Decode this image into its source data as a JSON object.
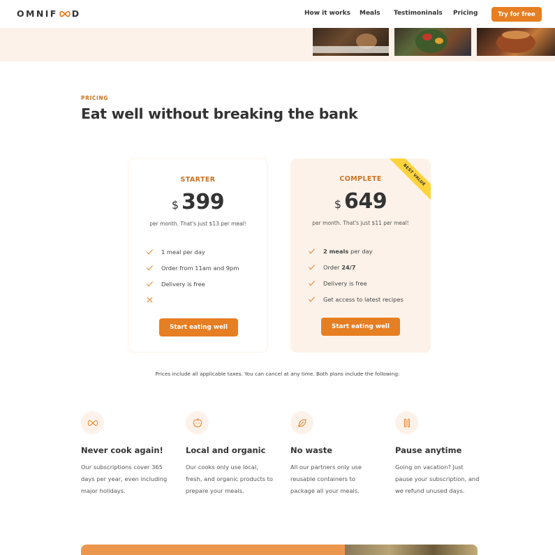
{
  "brand": {
    "logo_text": "OMNIFOOD",
    "accent": "#e67e22",
    "accent_dark": "#cf711f",
    "tint": "#fdf2e9",
    "ribbon": "#ffd43b"
  },
  "nav": {
    "items": [
      "How it works",
      "Meals",
      "Testimoninals",
      "Pricing"
    ],
    "cta_label": "Try for free"
  },
  "pricing": {
    "eyebrow": "PRICING",
    "heading": "Eat well without breaking the bank",
    "plans": [
      {
        "name": "STARTER",
        "currency": "$",
        "amount": "399",
        "per": "per month. That's just $13 per meal!",
        "features": [
          {
            "icon": "checkmark-icon",
            "text": "1 meal per day"
          },
          {
            "icon": "checkmark-icon",
            "text": "Order from 11am and 9pm"
          },
          {
            "icon": "checkmark-icon",
            "text": "Delivery is free"
          },
          {
            "icon": "close-icon",
            "text": ""
          }
        ],
        "button_label": "Start eating well"
      },
      {
        "name": "COMPLETE",
        "currency": "$",
        "amount": "649",
        "per": "per month. That's just $11 per meal!",
        "ribbon": "BEST VALUE",
        "features": [
          {
            "icon": "checkmark-icon",
            "bold": "2 meals",
            "text": " per day"
          },
          {
            "icon": "checkmark-icon",
            "prefix": "Order ",
            "bold": "24/7",
            "text": ""
          },
          {
            "icon": "checkmark-icon",
            "text": "Delivery is free"
          },
          {
            "icon": "checkmark-icon",
            "text": "Get access to latest recipes"
          }
        ],
        "button_label": "Start eating well"
      }
    ],
    "note": "Prices include all applicable taxes. You can cancel at any time. Both plans include the following:"
  },
  "features": [
    {
      "icon": "infinity-icon",
      "title": "Never cook again!",
      "text": "Our subscriptions cover 365 days per year, even including major holidays."
    },
    {
      "icon": "apple-icon",
      "title": "Local and organic",
      "text": "Our cooks only use local, fresh, and organic products to prepare your meals."
    },
    {
      "icon": "leaf-icon",
      "title": "No waste",
      "text": "All our partners only use reusable containers to package all your meals."
    },
    {
      "icon": "pause-icon",
      "title": "Pause anytime",
      "text": "Going on vacation? Just pause your subscription, and we refund unused days."
    }
  ]
}
